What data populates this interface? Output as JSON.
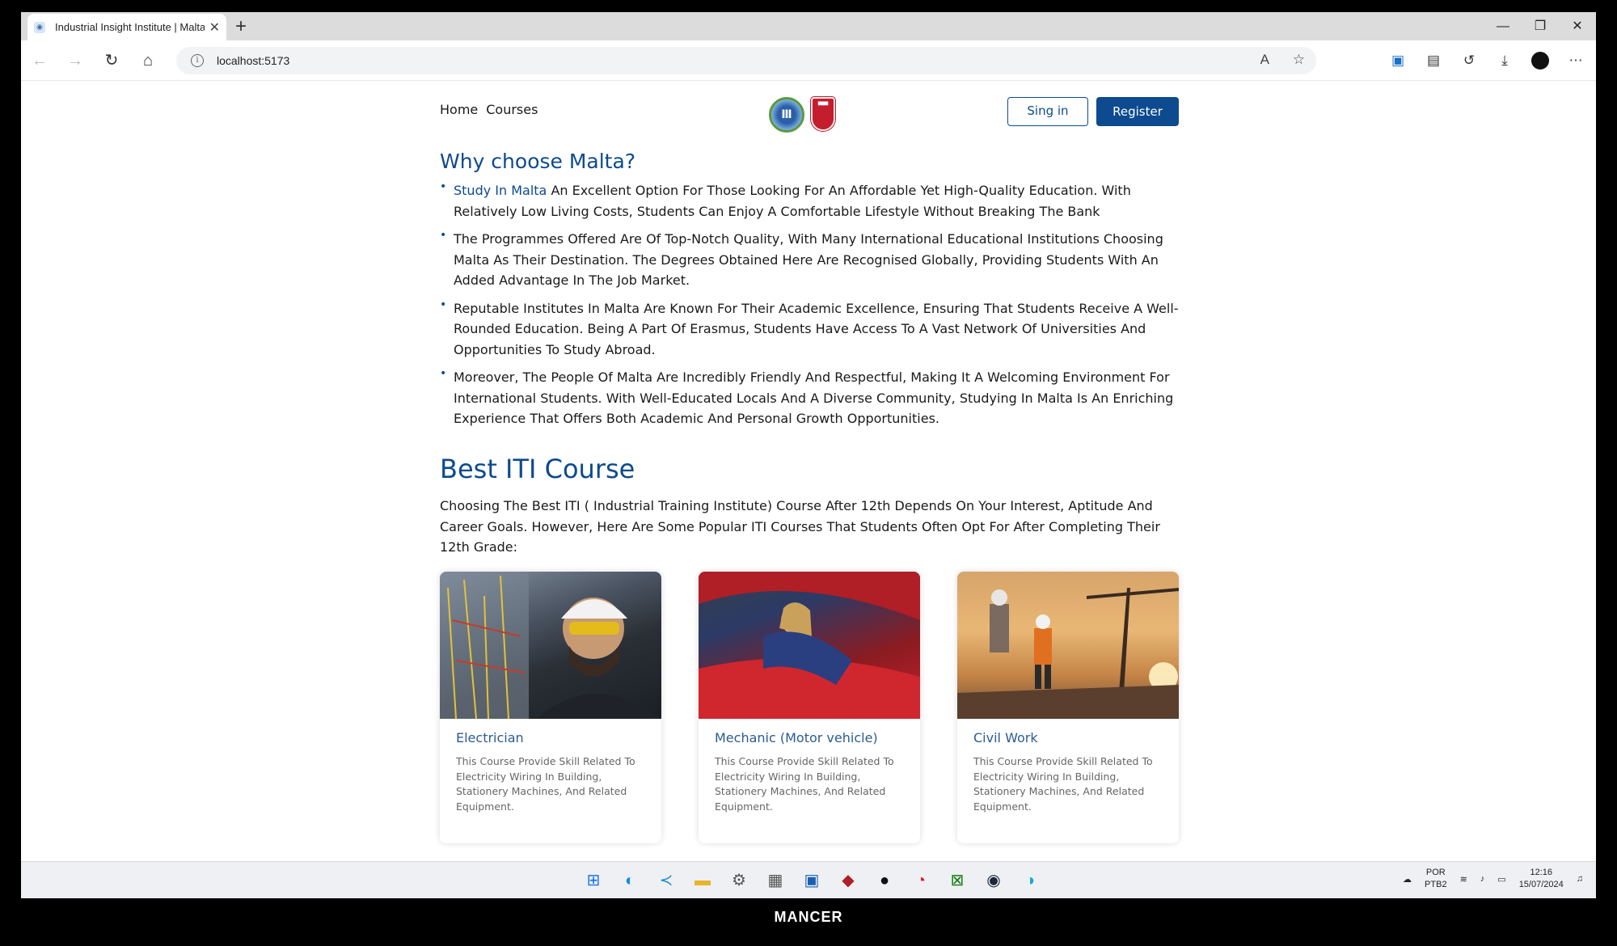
{
  "browser": {
    "tab_title": "Industrial Insight Institute | Malta",
    "url": "localhost:5173"
  },
  "nav": {
    "home": "Home",
    "courses": "Courses",
    "signin": "Sing in",
    "register": "Register"
  },
  "why": {
    "heading": "Why choose Malta?",
    "item1_highlight": "Study In Malta",
    "item1_rest": " An Excellent Option For Those Looking For An Affordable Yet High-Quality Education. With Relatively Low Living Costs, Students Can Enjoy A Comfortable Lifestyle Without Breaking The Bank",
    "item2": "The Programmes Offered Are Of Top-Notch Quality, With Many International Educational Institutions Choosing Malta As Their Destination. The Degrees Obtained Here Are Recognised Globally, Providing Students With An Added Advantage In The Job Market.",
    "item3": "Reputable Institutes In Malta Are Known For Their Academic Excellence, Ensuring That Students Receive A Well-Rounded Education. Being A Part Of Erasmus, Students Have Access To A Vast Network Of Universities And Opportunities To Study Abroad.",
    "item4": "Moreover, The People Of Malta Are Incredibly Friendly And Respectful, Making It A Welcoming Environment For International Students. With Well-Educated Locals And A Diverse Community, Studying In Malta Is An Enriching Experience That Offers Both Academic And Personal Growth Opportunities."
  },
  "best": {
    "heading": "Best ITI Course",
    "intro": "Choosing The Best ITI ( Industrial Training Institute) Course After 12th Depends On Your Interest, Aptitude And Career Goals. However, Here Are Some Popular ITI Courses That Students Often Opt For After Completing Their 12th Grade:"
  },
  "cards": [
    {
      "title": "Electrician",
      "desc": "This Course Provide Skill Related To Electricity Wiring In Building, Stationery Machines, And Related Equipment."
    },
    {
      "title": "Mechanic (Motor vehicle)",
      "desc": "This Course Provide Skill Related To Electricity Wiring In Building, Stationery Machines, And Related Equipment."
    },
    {
      "title": "Civil Work",
      "desc": "This Course Provide Skill Related To Electricity Wiring In Building, Stationery Machines, And Related Equipment."
    }
  ],
  "taskbar": {
    "lang_top": "POR",
    "lang_bottom": "PTB2",
    "time": "12:16",
    "date": "15/07/2024"
  },
  "footer_brand": "MANCER",
  "colors": {
    "primary": "#0d4a8f",
    "card_title": "#2b5c93"
  }
}
